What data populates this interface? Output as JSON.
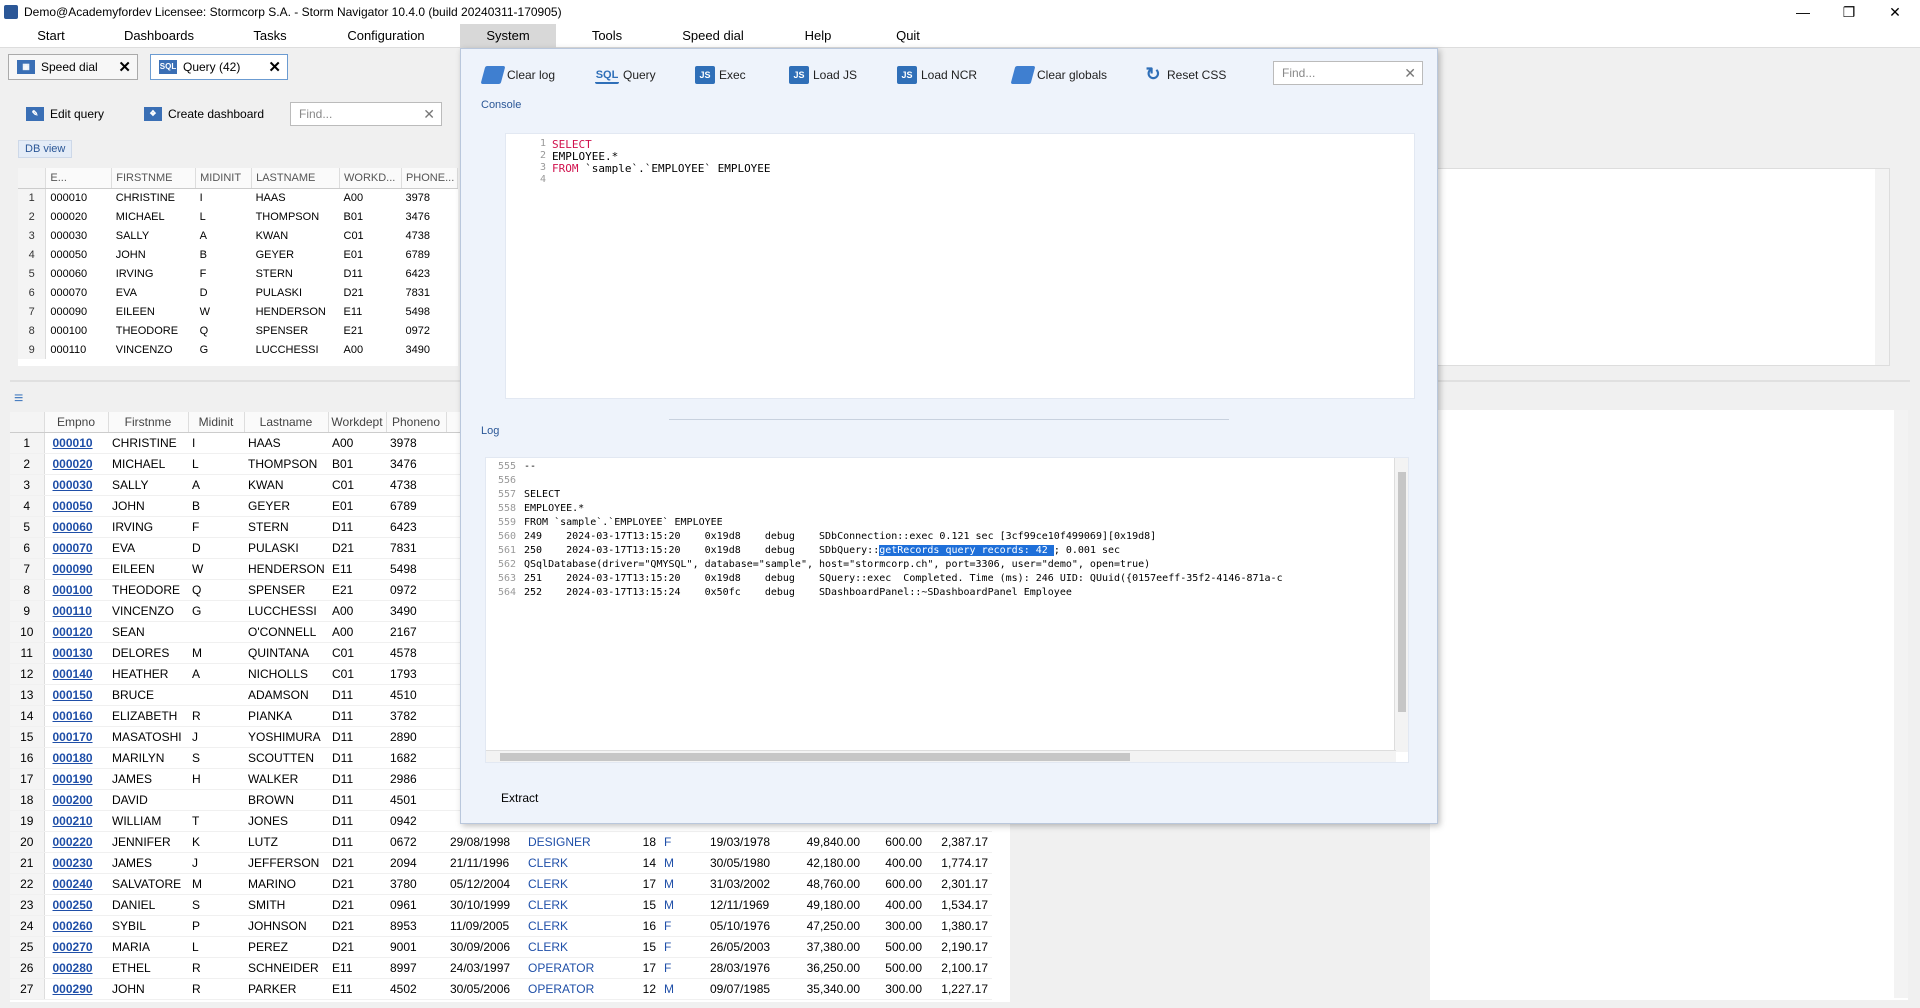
{
  "window": {
    "title": "Demo@Academyfordev   Licensee: Stormcorp S.A. -  Storm Navigator 10.4.0 (build 20240311-170905)",
    "minimize": "—",
    "maximize": "❐",
    "close": "✕"
  },
  "menu": [
    "Start",
    "Dashboards",
    "Tasks",
    "Configuration",
    "System",
    "Tools",
    "Speed dial",
    "Help",
    "Quit"
  ],
  "tabs": [
    {
      "label": "Speed dial",
      "close": "✕"
    },
    {
      "label": "Query (42)",
      "close": "✕"
    }
  ],
  "toolbar": {
    "edit_query": "Edit query",
    "create_dashboard": "Create dashboard",
    "find_placeholder": "Find..."
  },
  "db_view_label": "DB view",
  "grid1": {
    "headers": [
      "E...",
      "FIRSTNME",
      "MIDINIT",
      "LASTNAME",
      "WORKD...",
      "PHONE..."
    ],
    "rows": [
      [
        "1",
        "000010",
        "CHRISTINE",
        "I",
        "HAAS",
        "A00",
        "3978"
      ],
      [
        "2",
        "000020",
        "MICHAEL",
        "L",
        "THOMPSON",
        "B01",
        "3476"
      ],
      [
        "3",
        "000030",
        "SALLY",
        "A",
        "KWAN",
        "C01",
        "4738"
      ],
      [
        "4",
        "000050",
        "JOHN",
        "B",
        "GEYER",
        "E01",
        "6789"
      ],
      [
        "5",
        "000060",
        "IRVING",
        "F",
        "STERN",
        "D11",
        "6423"
      ],
      [
        "6",
        "000070",
        "EVA",
        "D",
        "PULASKI",
        "D21",
        "7831"
      ],
      [
        "7",
        "000090",
        "EILEEN",
        "W",
        "HENDERSON",
        "E11",
        "5498"
      ],
      [
        "8",
        "000100",
        "THEODORE",
        "Q",
        "SPENSER",
        "E21",
        "0972"
      ],
      [
        "9",
        "000110",
        "VINCENZO",
        "G",
        "LUCCHESSI",
        "A00",
        "3490"
      ]
    ]
  },
  "grid2": {
    "headers": [
      "Empno",
      "Firstnme",
      "Midinit",
      "Lastname",
      "Workdept",
      "Phoneno"
    ],
    "rows": [
      [
        "1",
        "000010",
        "CHRISTINE",
        "I",
        "HAAS",
        "A00",
        "3978",
        "",
        "",
        "",
        "",
        "",
        "",
        "",
        ""
      ],
      [
        "2",
        "000020",
        "MICHAEL",
        "L",
        "THOMPSON",
        "B01",
        "3476",
        "",
        "",
        "",
        "",
        "",
        "",
        "",
        ""
      ],
      [
        "3",
        "000030",
        "SALLY",
        "A",
        "KWAN",
        "C01",
        "4738",
        "",
        "",
        "",
        "",
        "",
        "",
        "",
        ""
      ],
      [
        "4",
        "000050",
        "JOHN",
        "B",
        "GEYER",
        "E01",
        "6789",
        "",
        "",
        "",
        "",
        "",
        "",
        "",
        ""
      ],
      [
        "5",
        "000060",
        "IRVING",
        "F",
        "STERN",
        "D11",
        "6423",
        "",
        "",
        "",
        "",
        "",
        "",
        "",
        ""
      ],
      [
        "6",
        "000070",
        "EVA",
        "D",
        "PULASKI",
        "D21",
        "7831",
        "",
        "",
        "",
        "",
        "",
        "",
        "",
        ""
      ],
      [
        "7",
        "000090",
        "EILEEN",
        "W",
        "HENDERSON",
        "E11",
        "5498",
        "",
        "",
        "",
        "",
        "",
        "",
        "",
        ""
      ],
      [
        "8",
        "000100",
        "THEODORE",
        "Q",
        "SPENSER",
        "E21",
        "0972",
        "",
        "",
        "",
        "",
        "",
        "",
        "",
        ""
      ],
      [
        "9",
        "000110",
        "VINCENZO",
        "G",
        "LUCCHESSI",
        "A00",
        "3490",
        "",
        "",
        "",
        "",
        "",
        "",
        "",
        ""
      ],
      [
        "10",
        "000120",
        "SEAN",
        "",
        "O'CONNELL",
        "A00",
        "2167",
        "",
        "",
        "",
        "",
        "",
        "",
        "",
        ""
      ],
      [
        "11",
        "000130",
        "DELORES",
        "M",
        "QUINTANA",
        "C01",
        "4578",
        "",
        "",
        "",
        "",
        "",
        "",
        "",
        ""
      ],
      [
        "12",
        "000140",
        "HEATHER",
        "A",
        "NICHOLLS",
        "C01",
        "1793",
        "",
        "",
        "",
        "",
        "",
        "",
        "",
        ""
      ],
      [
        "13",
        "000150",
        "BRUCE",
        "",
        "ADAMSON",
        "D11",
        "4510",
        "",
        "",
        "",
        "",
        "",
        "",
        "",
        ""
      ],
      [
        "14",
        "000160",
        "ELIZABETH",
        "R",
        "PIANKA",
        "D11",
        "3782",
        "",
        "",
        "",
        "",
        "",
        "",
        "",
        ""
      ],
      [
        "15",
        "000170",
        "MASATOSHI",
        "J",
        "YOSHIMURA",
        "D11",
        "2890",
        "",
        "",
        "",
        "",
        "",
        "",
        "",
        ""
      ],
      [
        "16",
        "000180",
        "MARILYN",
        "S",
        "SCOUTTEN",
        "D11",
        "1682",
        "",
        "",
        "",
        "",
        "",
        "",
        "",
        ""
      ],
      [
        "17",
        "000190",
        "JAMES",
        "H",
        "WALKER",
        "D11",
        "2986",
        "",
        "",
        "",
        "",
        "",
        "",
        "",
        ""
      ],
      [
        "18",
        "000200",
        "DAVID",
        "",
        "BROWN",
        "D11",
        "4501",
        "",
        "",
        "",
        "",
        "",
        "",
        "",
        ""
      ],
      [
        "19",
        "000210",
        "WILLIAM",
        "T",
        "JONES",
        "D11",
        "0942",
        "",
        "",
        "",
        "",
        "",
        "",
        "",
        ""
      ],
      [
        "20",
        "000220",
        "JENNIFER",
        "K",
        "LUTZ",
        "D11",
        "0672",
        "29/08/1998",
        "DESIGNER",
        "18",
        "F",
        "19/03/1978",
        "49,840.00",
        "600.00",
        "2,387.17"
      ],
      [
        "21",
        "000230",
        "JAMES",
        "J",
        "JEFFERSON",
        "D21",
        "2094",
        "21/11/1996",
        "CLERK",
        "14",
        "M",
        "30/05/1980",
        "42,180.00",
        "400.00",
        "1,774.17"
      ],
      [
        "22",
        "000240",
        "SALVATORE",
        "M",
        "MARINO",
        "D21",
        "3780",
        "05/12/2004",
        "CLERK",
        "17",
        "M",
        "31/03/2002",
        "48,760.00",
        "600.00",
        "2,301.17"
      ],
      [
        "23",
        "000250",
        "DANIEL",
        "S",
        "SMITH",
        "D21",
        "0961",
        "30/10/1999",
        "CLERK",
        "15",
        "M",
        "12/11/1969",
        "49,180.00",
        "400.00",
        "1,534.17"
      ],
      [
        "24",
        "000260",
        "SYBIL",
        "P",
        "JOHNSON",
        "D21",
        "8953",
        "11/09/2005",
        "CLERK",
        "16",
        "F",
        "05/10/1976",
        "47,250.00",
        "300.00",
        "1,380.17"
      ],
      [
        "25",
        "000270",
        "MARIA",
        "L",
        "PEREZ",
        "D21",
        "9001",
        "30/09/2006",
        "CLERK",
        "15",
        "F",
        "26/05/2003",
        "37,380.00",
        "500.00",
        "2,190.17"
      ],
      [
        "26",
        "000280",
        "ETHEL",
        "R",
        "SCHNEIDER",
        "E11",
        "8997",
        "24/03/1997",
        "OPERATOR",
        "17",
        "F",
        "28/03/1976",
        "36,250.00",
        "500.00",
        "2,100.17"
      ],
      [
        "27",
        "000290",
        "JOHN",
        "R",
        "PARKER",
        "E11",
        "4502",
        "30/05/2006",
        "OPERATOR",
        "12",
        "M",
        "09/07/1985",
        "35,340.00",
        "300.00",
        "1,227.17"
      ]
    ]
  },
  "system_panel": {
    "buttons": [
      "Clear log",
      "Query",
      "Exec",
      "Load JS",
      "Load NCR",
      "Clear globals",
      "Reset CSS"
    ],
    "find_placeholder": "Find...",
    "console_label": "Console",
    "console_lines": [
      {
        "n": "1",
        "text": "SELECT",
        "kw": true
      },
      {
        "n": "2",
        "text": "EMPLOYEE.*",
        "kw": false
      },
      {
        "n": "3",
        "text": "FROM `sample`.`EMPLOYEE` EMPLOYEE",
        "kw": true
      },
      {
        "n": "4",
        "text": "",
        "kw": false
      }
    ],
    "log_label": "Log",
    "log_lines": [
      {
        "n": "555",
        "text": "--"
      },
      {
        "n": "556",
        "text": ""
      },
      {
        "n": "557",
        "text": "SELECT"
      },
      {
        "n": "558",
        "text": "EMPLOYEE.*"
      },
      {
        "n": "559",
        "text": "FROM `sample`.`EMPLOYEE` EMPLOYEE"
      },
      {
        "n": "560",
        "text": "249    2024-03-17T13:15:20    0x19d8    debug    SDbConnection::exec 0.121 sec [3cf99ce10f499069][0x19d8]"
      },
      {
        "n": "561",
        "pre": "250    2024-03-17T13:15:20    0x19d8    debug    SDbQuery::",
        "hl": "getRecords query records: 42 ",
        "post": "; 0.001 sec"
      },
      {
        "n": "562",
        "text": "QSqlDatabase(driver=\"QMYSQL\", database=\"sample\", host=\"stormcorp.ch\", port=3306, user=\"demo\", open=true)"
      },
      {
        "n": "563",
        "text": "251    2024-03-17T13:15:20    0x19d8    debug    SQuery::exec  Completed. Time (ms): 246 UID: QUuid({0157eeff-35f2-4146-871a-c"
      },
      {
        "n": "564",
        "text": "252    2024-03-17T13:15:24    0x50fc    debug    SDashboardPanel::~SDashboardPanel Employee"
      }
    ],
    "extract": "Extract"
  }
}
